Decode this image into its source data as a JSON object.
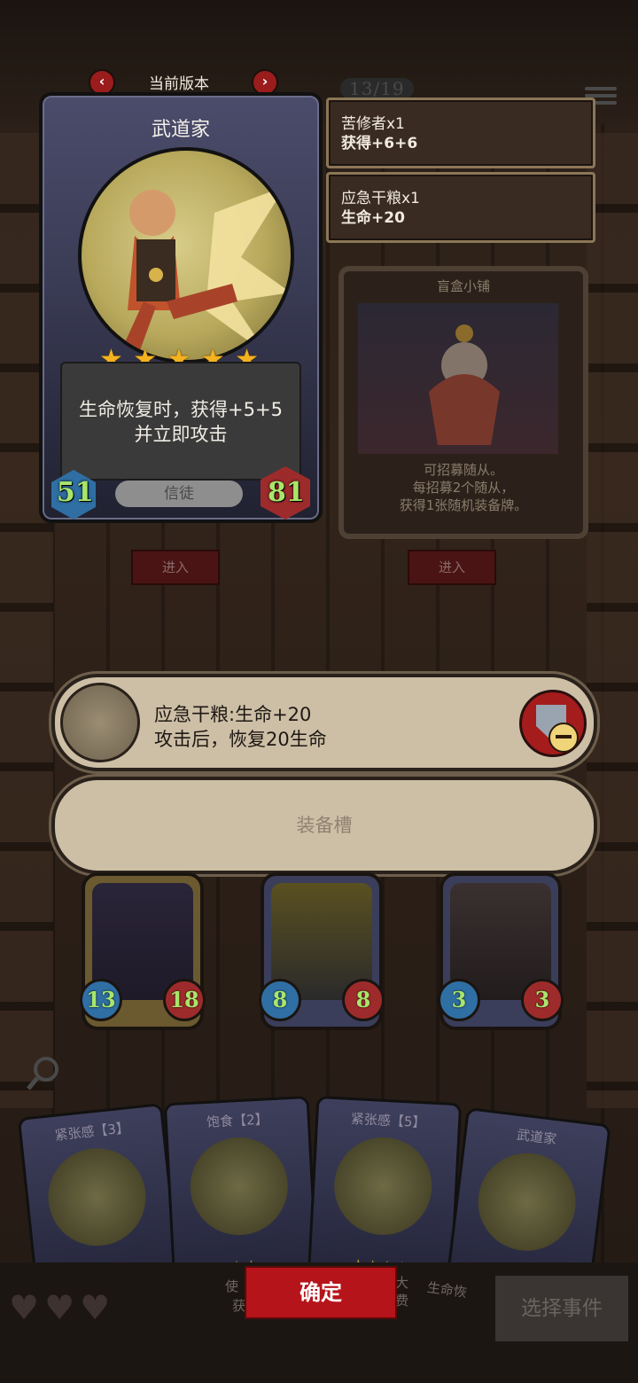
{
  "header": {
    "version_label": "当前版本",
    "counter": "13/19"
  },
  "hero_card": {
    "title": "武道家",
    "stars": 5,
    "description_line1": "生命恢复时，获得+5+5",
    "description_line2": "并立即攻击",
    "attack": "51",
    "health": "81",
    "tag": "信徒"
  },
  "events": [
    {
      "name": "苦修者x1",
      "effect": "获得+6+6"
    },
    {
      "name": "应急干粮x1",
      "effect": "生命+20"
    }
  ],
  "shop": {
    "title": "盲盒小铺",
    "desc_line1": "可招募随从。",
    "desc_line2": "每招募2个随从，",
    "desc_line3": "获得1张随机装备牌。"
  },
  "enter_buttons": [
    "进入",
    "进入"
  ],
  "equipped_item": {
    "name": "应急干粮:生命+20",
    "description": "攻击后，恢复20生命"
  },
  "equip_slot_label": "装备槽",
  "followers": [
    {
      "attack": "13",
      "health": "18",
      "color": "#5a4a2a"
    },
    {
      "attack": "8",
      "health": "8",
      "color": "#3a3e5a"
    },
    {
      "attack": "3",
      "health": "3",
      "color": "#3a3e5a"
    }
  ],
  "hand_cards": [
    {
      "title": "紧张感【3】",
      "stars": "★"
    },
    {
      "title": "饱食【2】",
      "stars": "★★"
    },
    {
      "title": "紧张感【5】",
      "stars": "★★★★"
    },
    {
      "title": "武道家",
      "stars": "★★"
    }
  ],
  "hand_partial_texts": [
    "使",
    "获",
    "大",
    "费",
    "生命恢"
  ],
  "bottom": {
    "confirm_label": "确定",
    "choose_event_label": "选择事件",
    "hearts": 3
  },
  "colors": {
    "accent_red": "#b5141a",
    "attack_blue": "#2f6fa3",
    "health_red": "#9e2b2b",
    "stat_green": "#a8e66a"
  }
}
